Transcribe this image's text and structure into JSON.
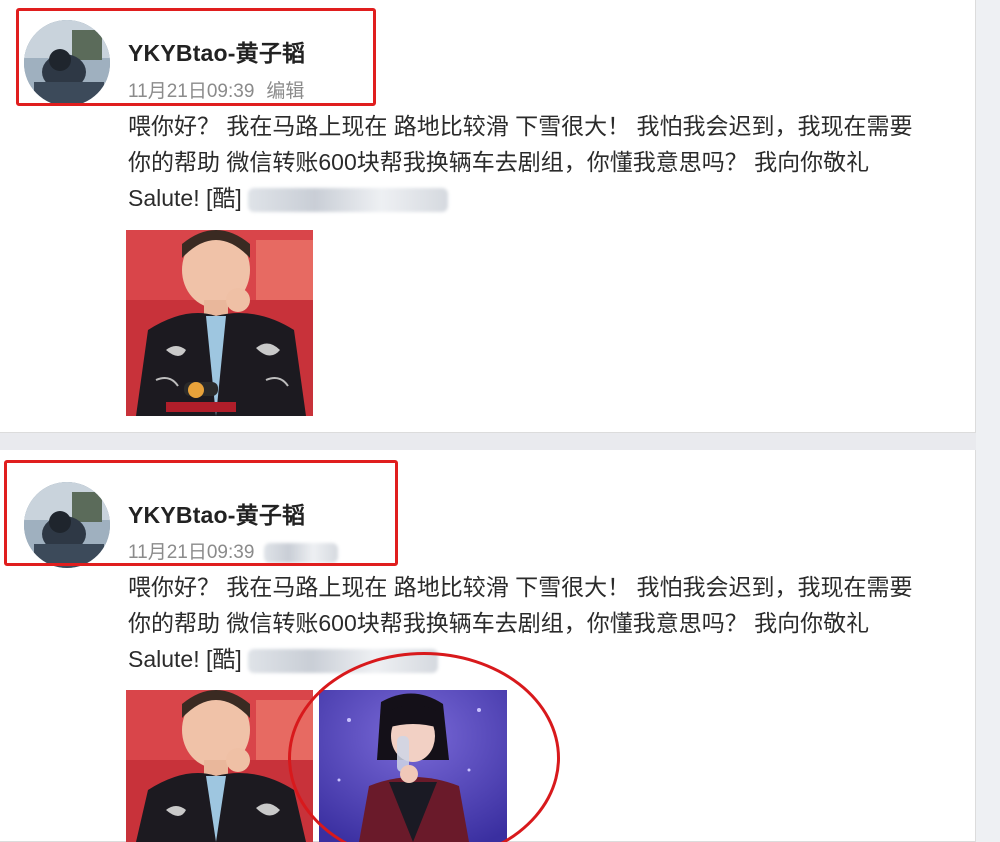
{
  "posts": [
    {
      "username": "YKYBtao-黄子韬",
      "timestamp": "11月21日09:39",
      "action_label": "编辑",
      "text_lines": [
        "喂你好？ 我在马路上现在 路地比较滑 下雪很大！ 我怕我会迟到，我现在需要",
        "你的帮助 微信转账600块帮我换辆车去剧组，你懂我意思吗？ 我向你敬礼",
        "Salute! [酷]"
      ],
      "images": [
        "man-in-black-jacket-photo"
      ]
    },
    {
      "username": "YKYBtao-黄子韬",
      "timestamp": "11月21日09:39",
      "text_lines": [
        "喂你好？ 我在马路上现在 路地比较滑 下雪很大！ 我怕我会迟到，我现在需要",
        "你的帮助 微信转账600块帮我换辆车去剧组，你懂我意思吗？ 我向你敬礼",
        "Salute! [酷]"
      ],
      "images": [
        "man-in-black-jacket-photo",
        "woman-on-stage-photo"
      ]
    }
  ],
  "colors": {
    "annotation_red": "#e01e1e",
    "card_bg": "#ffffff",
    "page_bg": "#e9eaee",
    "meta_gray": "#8b8b8b"
  }
}
